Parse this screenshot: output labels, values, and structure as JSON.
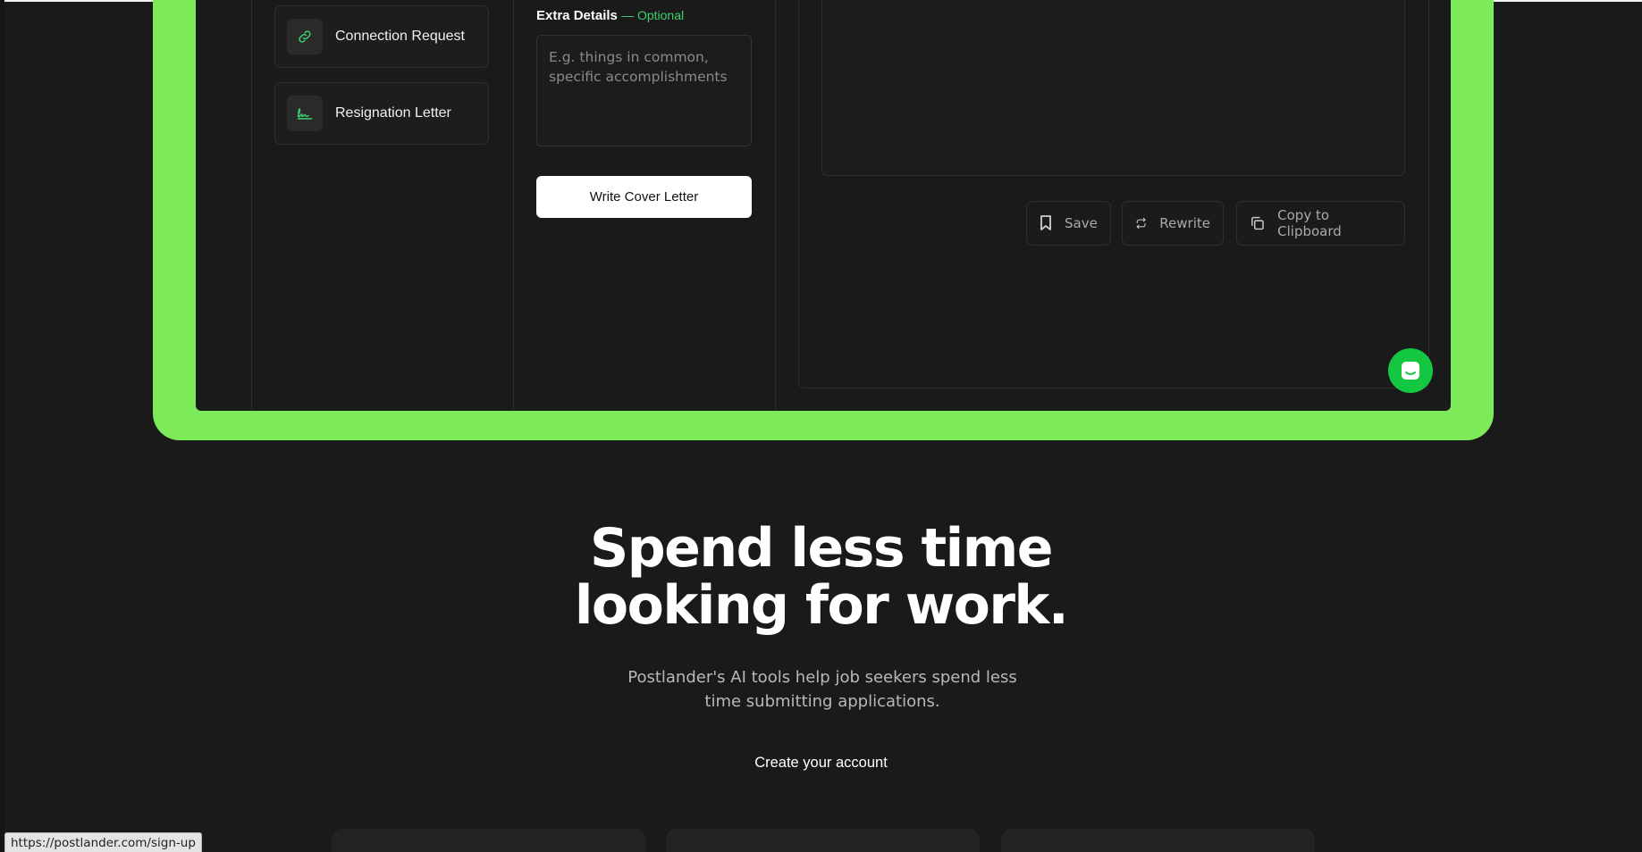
{
  "sidebar": {
    "items": [
      {
        "label": "Connection Request",
        "icon": "link-icon"
      },
      {
        "label": "Resignation Letter",
        "icon": "signature-icon"
      }
    ]
  },
  "form": {
    "extra_details_label": "Extra Details",
    "extra_details_optional": "— Optional",
    "extra_details_placeholder": "E.g. things in common, specific accomplishments",
    "submit_label": "Write Cover Letter"
  },
  "output": {
    "actions": [
      {
        "label": "Save",
        "icon": "bookmark-icon"
      },
      {
        "label": "Rewrite",
        "icon": "repeat-icon"
      },
      {
        "label": "Copy to Clipboard",
        "icon": "copy-icon"
      }
    ]
  },
  "chat": {
    "icon": "chat-icon"
  },
  "hero": {
    "title_line1": "Spend less time",
    "title_line2": "looking for work.",
    "subtitle": "Postlander's AI tools help job seekers spend less time submitting applications.",
    "cta": "Create your account"
  },
  "status_bar": {
    "url": "https://postlander.com/sign-up"
  },
  "colors": {
    "frame_green": "#7dea5a",
    "accent_green": "#3bd16f",
    "chat_green": "#13c840",
    "background": "#191a19"
  }
}
